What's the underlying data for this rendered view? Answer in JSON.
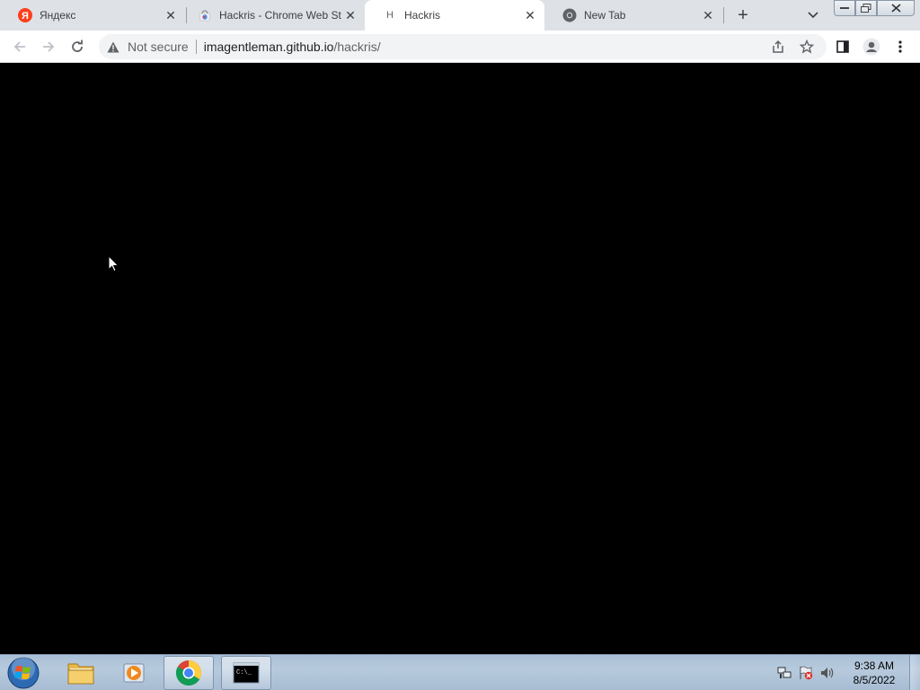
{
  "browser": {
    "tabs": [
      {
        "title": "Яндекс",
        "favicon": "yandex-icon",
        "favicon_letter": "Я",
        "active": false
      },
      {
        "title": "Hackris - Chrome Web St",
        "favicon": "chrome-web-store-icon",
        "active": false
      },
      {
        "title": "Hackris",
        "favicon": "hackris-favicon",
        "favicon_letter": "H",
        "active": true
      },
      {
        "title": "New Tab",
        "favicon": "chrome-icon",
        "active": false
      }
    ],
    "new_tab_label": "+",
    "address_bar": {
      "security_text": "Not secure",
      "url_host": "imagentleman.github.io",
      "url_path": "/hackris/"
    }
  },
  "page": {
    "background": "#000000"
  },
  "taskbar": {
    "clock_time": "9:38 AM",
    "clock_date": "8/5/2022",
    "apps": [
      {
        "name": "windows-explorer",
        "icon": "folder-icon"
      },
      {
        "name": "media-player",
        "icon": "media-player-icon"
      },
      {
        "name": "google-chrome",
        "icon": "chrome-icon",
        "running": true
      },
      {
        "name": "command-prompt",
        "icon": "cmd-icon",
        "running": true
      }
    ]
  },
  "colors": {
    "tabstrip_bg": "#dee1e6",
    "toolbar_bg": "#ffffff",
    "omnibox_bg": "#f1f3f4",
    "taskbar_bg": "#b7cadd"
  }
}
